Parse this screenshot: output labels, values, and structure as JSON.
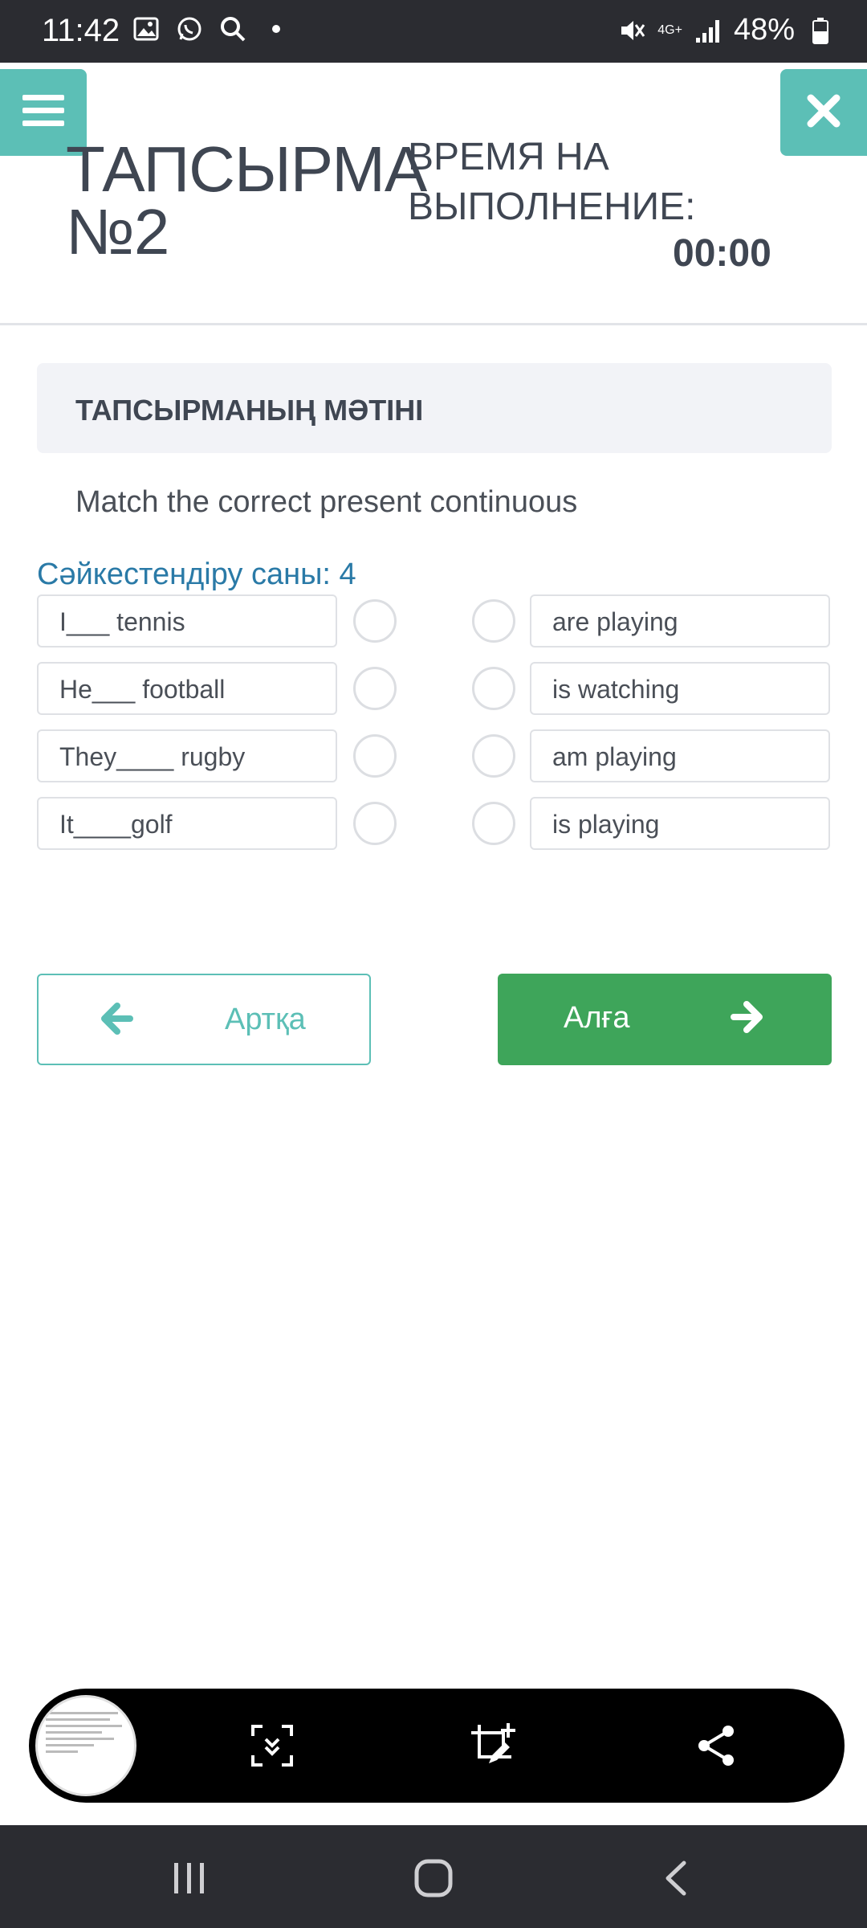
{
  "status_bar": {
    "time": "11:42",
    "battery": "48%",
    "network": "4G+"
  },
  "header": {
    "title": "ТАПСЫРМА №2",
    "time_label": "ВРЕМЯ НА ВЫПОЛНЕНИЕ:",
    "time_value": "00:00"
  },
  "task": {
    "section_title": "ТАПСЫРМАНЫҢ МӘТІНІ",
    "question": "Match the correct present continuous",
    "match_count_label": "Сәйкестендіру саны: 4"
  },
  "left_items": [
    "I___ tennis",
    "He___ football",
    "They____ rugby",
    "It____golf"
  ],
  "right_items": [
    "are playing",
    "is watching",
    "am playing",
    "is playing"
  ],
  "navigation": {
    "back_label": "Артқа",
    "next_label": "Алға"
  },
  "colors": {
    "accent": "#5cbfb6",
    "next": "#3ea55a",
    "count": "#2a7aa7"
  }
}
